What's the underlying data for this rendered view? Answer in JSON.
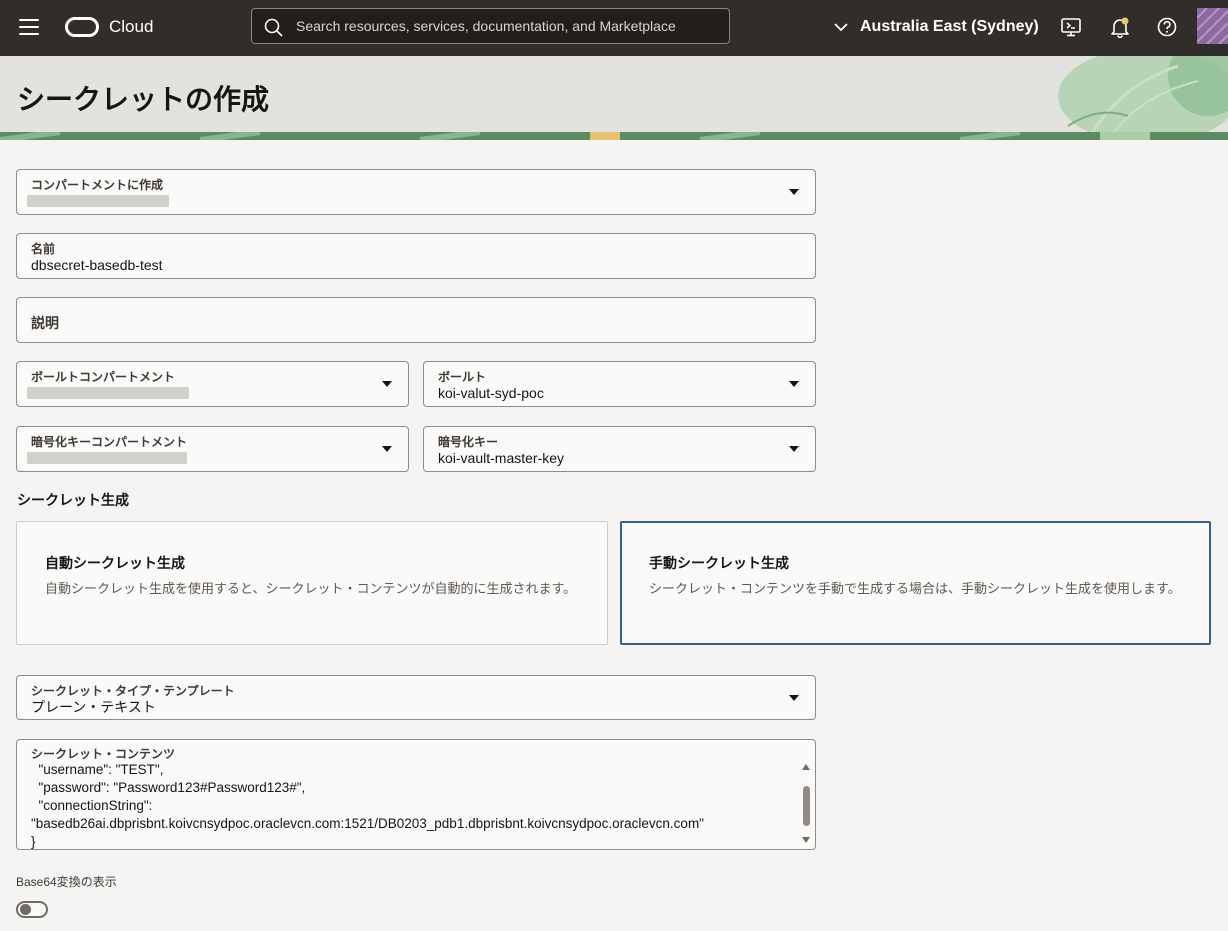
{
  "topbar": {
    "brand": "Cloud",
    "search_placeholder": "Search resources, services, documentation, and Marketplace",
    "region": "Australia East (Sydney)",
    "icons": [
      "menu-icon",
      "oracle-logo-icon",
      "search-icon",
      "chevron-down-icon",
      "cloud-shell-icon",
      "bell-icon",
      "help-icon",
      "avatar"
    ]
  },
  "page": {
    "title": "シークレットの作成"
  },
  "form": {
    "compartment": {
      "label": "コンパートメントに作成"
    },
    "name": {
      "label": "名前",
      "value": "dbsecret-basedb-test"
    },
    "description": {
      "label": "説明"
    },
    "vault_compartment": {
      "label": "ボールトコンパートメント"
    },
    "vault": {
      "label": "ボールト",
      "value": "koi-valut-syd-poc"
    },
    "key_compartment": {
      "label": "暗号化キーコンパートメント"
    },
    "key": {
      "label": "暗号化キー",
      "value": "koi-vault-master-key"
    },
    "generation_title": "シークレット生成",
    "auto_card": {
      "title": "自動シークレット生成",
      "description": "自動シークレット生成を使用すると、シークレット・コンテンツが自動的に生成されます。"
    },
    "manual_card": {
      "title": "手動シークレット生成",
      "description": "シークレット・コンテンツを手動で生成する場合は、手動シークレット生成を使用します。"
    },
    "template": {
      "label": "シークレット・タイプ・テンプレート",
      "value": "プレーン・テキスト"
    },
    "contents": {
      "label": "シークレット・コンテンツ",
      "value": "  \"username\": \"TEST\",\n  \"password\": \"Password123#Password123#\",\n  \"connectionString\":\n\"basedb26ai.dbprisbnt.koivcnsydpoc.oraclevcn.com:1521/DB0203_pdb1.dbprisbnt.koivcnsydpoc.oraclevcn.com\"\n}"
    },
    "base64_label": "Base64変換の表示",
    "base64_on": false
  },
  "colors": {
    "topbar": "#312d2a",
    "selected_border": "#31628f",
    "page_bg": "#f5f4f2"
  }
}
